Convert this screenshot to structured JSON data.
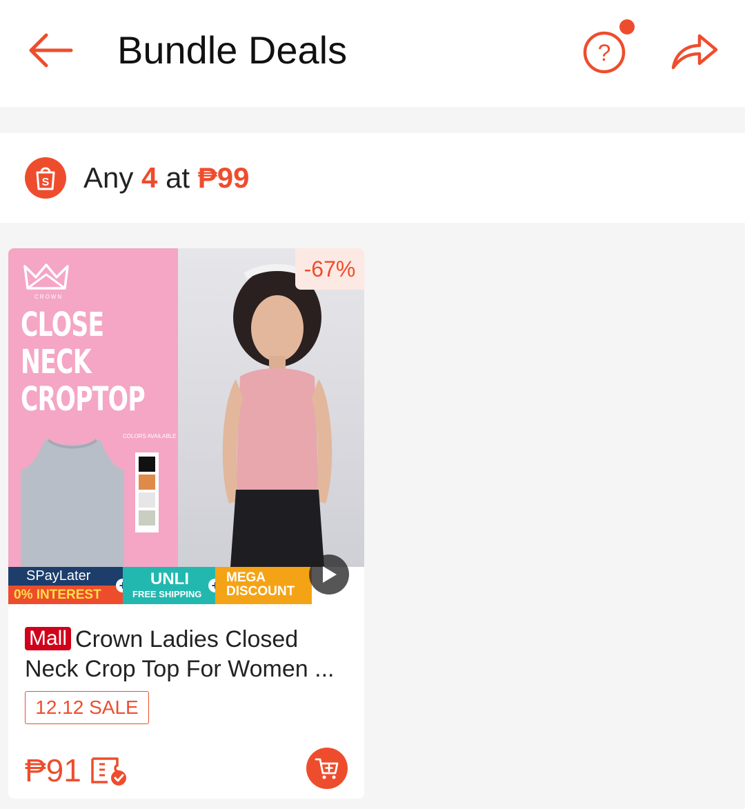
{
  "header": {
    "title": "Bundle Deals",
    "back_icon": "arrow-left-icon",
    "help_icon": "question-circle-icon",
    "share_icon": "share-arrow-icon"
  },
  "deal": {
    "prefix": "Any",
    "quantity": "4",
    "middle": "at",
    "price": "₱99",
    "icon": "shopee-bag-icon"
  },
  "products": [
    {
      "discount": "-67%",
      "mall_badge": "Mall",
      "name": "Crown Ladies Closed Neck Crop Top For Women ...",
      "sale_tag": "12.12 SALE",
      "price": "₱91",
      "image": {
        "brand": "CROWN",
        "headline_1": "CLOSE",
        "headline_2": "NECK",
        "headline_3": "CROPTOP",
        "colors_label": "COLORS AVAILABLE",
        "swatch_colors": [
          "#111111",
          "#e08a4a",
          "#e6e6e6",
          "#c8cfc0"
        ],
        "strip_spaylater": "SPayLater",
        "strip_interest": "0% INTEREST",
        "strip_unli": "UNLI",
        "strip_free_shipping": "FREE SHIPPING",
        "strip_mega": "MEGA",
        "strip_discount": "DISCOUNT"
      }
    }
  ],
  "colors": {
    "accent": "#ee4d2d",
    "mall_red": "#d0011b"
  }
}
